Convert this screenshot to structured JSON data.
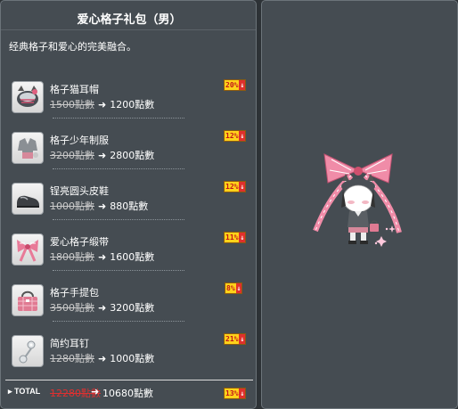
{
  "header": {
    "id_tag": "09105566",
    "title": "爱心格子礼包（男）"
  },
  "description": "经典格子和爱心的完美融合。",
  "items": [
    {
      "name": "格子猫耳帽",
      "old_price": "1500點數",
      "new_price": "1200點數",
      "discount": "20%",
      "icon": "cat-ear-hat-icon"
    },
    {
      "name": "格子少年制服",
      "old_price": "3200點數",
      "new_price": "2800點數",
      "discount": "12%",
      "icon": "uniform-icon"
    },
    {
      "name": "锃亮圆头皮鞋",
      "old_price": "1000點數",
      "new_price": "880點數",
      "discount": "12%",
      "icon": "shoe-icon"
    },
    {
      "name": "爱心格子缎带",
      "old_price": "1800點數",
      "new_price": "1600點數",
      "discount": "11%",
      "icon": "ribbon-icon"
    },
    {
      "name": "格子手提包",
      "old_price": "3500點數",
      "new_price": "3200點數",
      "discount": "8%",
      "icon": "handbag-icon"
    },
    {
      "name": "简约耳钉",
      "old_price": "1280點數",
      "new_price": "1000點數",
      "discount": "21%",
      "icon": "earring-icon"
    }
  ],
  "total": {
    "label": "TOTAL",
    "old_price": "12280點數",
    "new_price": "10680點數",
    "discount": "13%"
  },
  "symbols": {
    "arrow": "➜",
    "down": "↓",
    "bullet": "▸"
  },
  "colors": {
    "panel": "#454c52",
    "background": "#2d3236",
    "badge": "#ffd21a",
    "strike_total": "#e03030"
  }
}
